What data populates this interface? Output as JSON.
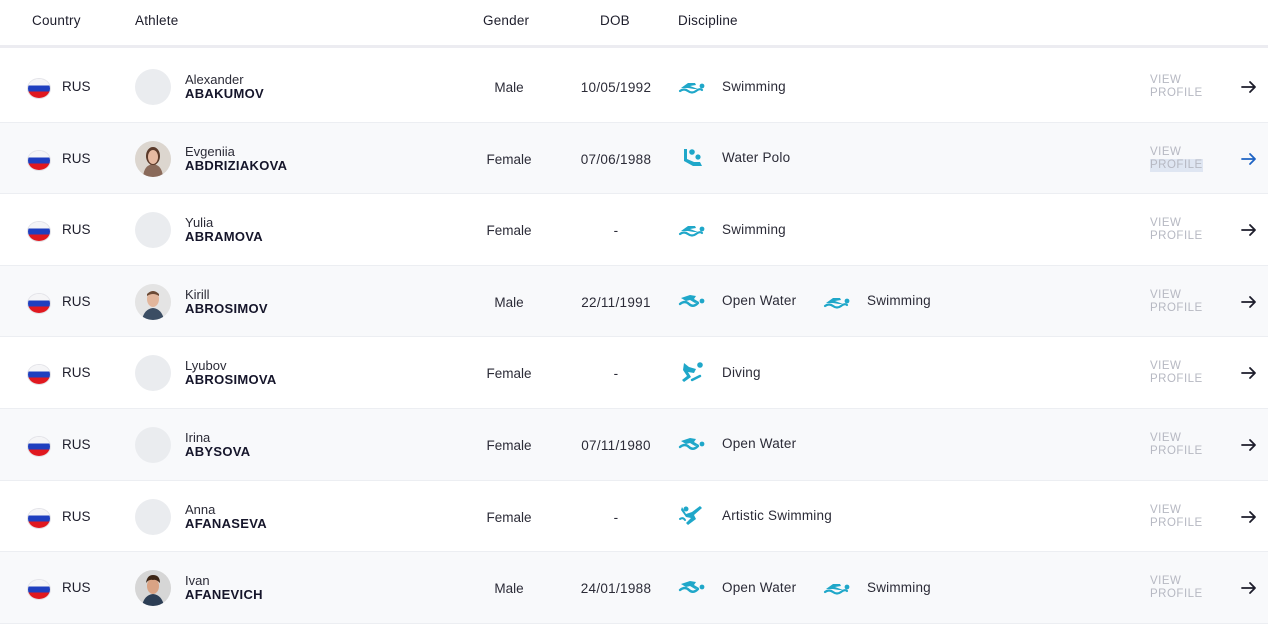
{
  "header": {
    "country": "Country",
    "athlete": "Athlete",
    "gender": "Gender",
    "dob": "DOB",
    "discipline": "Discipline"
  },
  "view_profile": {
    "line1": "VIEW",
    "line2": "PROFILE"
  },
  "colors": {
    "accent": "#1fa7c9",
    "arrow": "#1d1d2b",
    "arrow_active": "#1e63c4"
  },
  "rows": [
    {
      "country": "RUS",
      "first": "Alexander",
      "last": "ABAKUMOV",
      "gender": "Male",
      "dob": "10/05/1992",
      "avatar": "placeholder",
      "disciplines": [
        {
          "icon": "swimming-icon",
          "name": "Swimming"
        }
      ]
    },
    {
      "country": "RUS",
      "first": "Evgeniia",
      "last": "ABDRIZIAKOVA",
      "gender": "Female",
      "dob": "07/06/1988",
      "avatar": "photo",
      "disciplines": [
        {
          "icon": "water-polo-icon",
          "name": "Water Polo"
        }
      ]
    },
    {
      "country": "RUS",
      "first": "Yulia",
      "last": "ABRAMOVA",
      "gender": "Female",
      "dob": "-",
      "avatar": "placeholder",
      "disciplines": [
        {
          "icon": "swimming-icon",
          "name": "Swimming"
        }
      ]
    },
    {
      "country": "RUS",
      "first": "Kirill",
      "last": "ABROSIMOV",
      "gender": "Male",
      "dob": "22/11/1991",
      "avatar": "photo",
      "disciplines": [
        {
          "icon": "open-water-icon",
          "name": "Open Water"
        },
        {
          "icon": "swimming-icon",
          "name": "Swimming"
        }
      ]
    },
    {
      "country": "RUS",
      "first": "Lyubov",
      "last": "ABROSIMOVA",
      "gender": "Female",
      "dob": "-",
      "avatar": "placeholder",
      "disciplines": [
        {
          "icon": "diving-icon",
          "name": "Diving"
        }
      ]
    },
    {
      "country": "RUS",
      "first": "Irina",
      "last": "ABYSOVA",
      "gender": "Female",
      "dob": "07/11/1980",
      "avatar": "placeholder",
      "disciplines": [
        {
          "icon": "open-water-icon",
          "name": "Open Water"
        }
      ]
    },
    {
      "country": "RUS",
      "first": "Anna",
      "last": "AFANASEVA",
      "gender": "Female",
      "dob": "-",
      "avatar": "placeholder",
      "disciplines": [
        {
          "icon": "artistic-swimming-icon",
          "name": "Artistic Swimming"
        }
      ]
    },
    {
      "country": "RUS",
      "first": "Ivan",
      "last": "AFANEVICH",
      "gender": "Male",
      "dob": "24/01/1988",
      "avatar": "photo",
      "disciplines": [
        {
          "icon": "open-water-icon",
          "name": "Open Water"
        },
        {
          "icon": "swimming-icon",
          "name": "Swimming"
        }
      ]
    }
  ]
}
